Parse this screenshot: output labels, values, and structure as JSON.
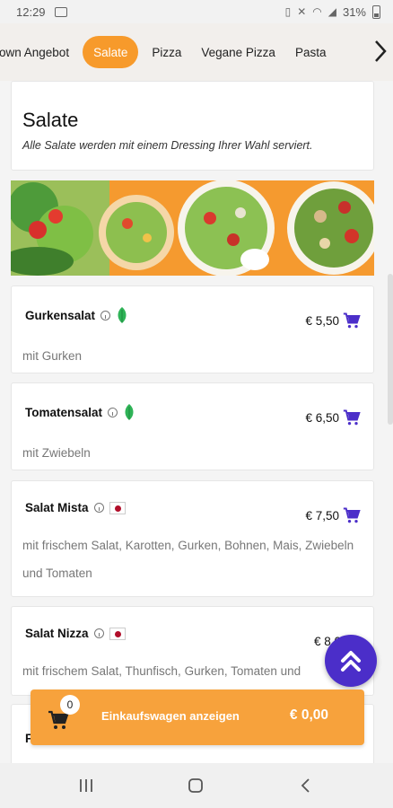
{
  "status_bar": {
    "time": "12:29",
    "battery": "31%"
  },
  "tabs": {
    "items": [
      {
        "label": "own Angebot",
        "active": false
      },
      {
        "label": "Salate",
        "active": true
      },
      {
        "label": "Pizza",
        "active": false
      },
      {
        "label": "Vegane Pizza",
        "active": false
      },
      {
        "label": "Pasta",
        "active": false
      }
    ]
  },
  "section": {
    "title": "Salate",
    "subtitle": "Alle Salate werden mit einem Dressing Ihrer Wahl serviert."
  },
  "items": [
    {
      "name": "Gurkensalat",
      "price": "€ 5,50",
      "desc": "mit Gurken",
      "badge": "vegan-leaf"
    },
    {
      "name": "Tomatensalat",
      "price": "€ 6,50",
      "desc": "mit Zwiebeln",
      "badge": "vegan-leaf"
    },
    {
      "name": "Salat Mista",
      "price": "€ 7,50",
      "desc": "mit frischem Salat, Karotten, Gurken, Bohnen, Mais, Zwiebeln und Tomaten",
      "badge": "red-marker"
    },
    {
      "name": "Salat Nizza",
      "price": "€ 8,0",
      "desc": "mit frischem Salat, Thunfisch, Gurken, Tomaten und",
      "badge": "red-marker"
    },
    {
      "name": "F",
      "price": "",
      "desc": "",
      "badge": ""
    }
  ],
  "cart": {
    "count": "0",
    "label": "Einkaufswagen anzeigen",
    "total": "€ 0,00"
  },
  "colors": {
    "accent": "#f79a2b",
    "primary": "#4b2ec9",
    "leaf": "#2fb357",
    "marker": "#b10e2a"
  }
}
